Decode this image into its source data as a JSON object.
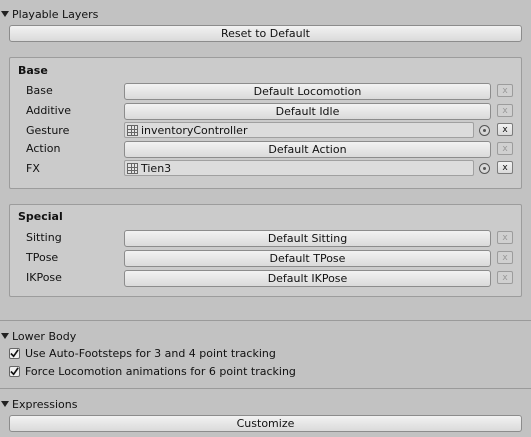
{
  "playable_layers": {
    "header": "Playable Layers",
    "reset_button": "Reset to Default",
    "base_group": {
      "title": "Base",
      "rows": [
        {
          "label": "Base",
          "value": "Default Locomotion"
        },
        {
          "label": "Additive",
          "value": "Default Idle"
        },
        {
          "label": "Gesture",
          "value": "inventoryController"
        },
        {
          "label": "Action",
          "value": "Default Action"
        },
        {
          "label": "FX",
          "value": "Tien3"
        }
      ]
    },
    "special_group": {
      "title": "Special",
      "rows": [
        {
          "label": "Sitting",
          "value": "Default Sitting"
        },
        {
          "label": "TPose",
          "value": "Default TPose"
        },
        {
          "label": "IKPose",
          "value": "Default IKPose"
        }
      ]
    },
    "remove_glyph": "x"
  },
  "lower_body": {
    "header": "Lower Body",
    "options": [
      {
        "label": "Use Auto-Footsteps for 3 and 4 point tracking",
        "checked": true
      },
      {
        "label": "Force Locomotion animations for 6 point tracking",
        "checked": true
      }
    ]
  },
  "expressions": {
    "header": "Expressions",
    "customize_button": "Customize"
  },
  "colors": {
    "background": "#c2c2c2",
    "group_background": "#cbcbcb",
    "button_gradient_top": "#f2f2f2",
    "button_gradient_bottom": "#dadada"
  },
  "icons": {
    "foldout": "foldout-triangle-icon",
    "controller": "animator-controller-icon",
    "picker": "object-picker-icon",
    "check": "checkmark-icon"
  }
}
